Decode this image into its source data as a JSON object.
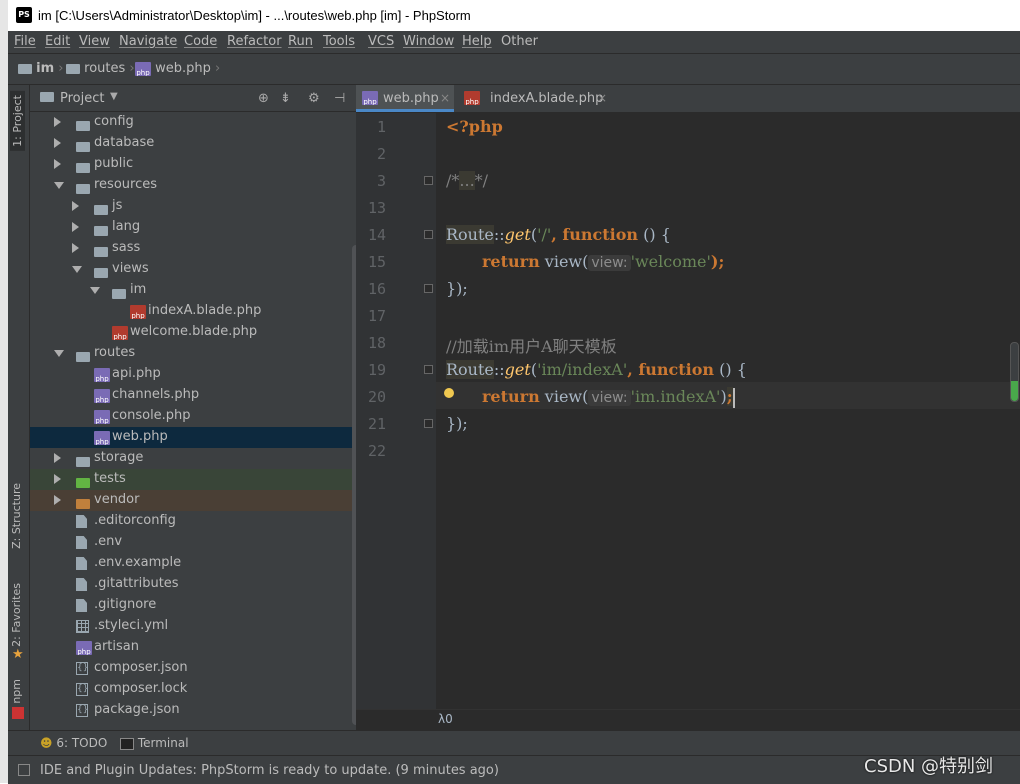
{
  "window": {
    "title": "im [C:\\Users\\Administrator\\Desktop\\im] - ...\\routes\\web.php [im] - PhpStorm",
    "app_icon": "PS"
  },
  "menu": [
    "File",
    "Edit",
    "View",
    "Navigate",
    "Code",
    "Refactor",
    "Run",
    "Tools",
    "VCS",
    "Window",
    "Help",
    "Other"
  ],
  "breadcrumb": [
    "im",
    "routes",
    "web.php"
  ],
  "tool_windows": {
    "left_top": "1: Project",
    "left_structure": "Z: Structure",
    "left_favorites": "2: Favorites",
    "left_npm": "npm"
  },
  "project": {
    "title": "Project",
    "tree": [
      {
        "label": "config",
        "type": "folder",
        "depth": 1,
        "expanded": false
      },
      {
        "label": "database",
        "type": "folder",
        "depth": 1,
        "expanded": false
      },
      {
        "label": "public",
        "type": "folder",
        "depth": 1,
        "expanded": false
      },
      {
        "label": "resources",
        "type": "folder",
        "depth": 1,
        "expanded": true
      },
      {
        "label": "js",
        "type": "folder",
        "depth": 2,
        "expanded": false
      },
      {
        "label": "lang",
        "type": "folder",
        "depth": 2,
        "expanded": false
      },
      {
        "label": "sass",
        "type": "folder",
        "depth": 2,
        "expanded": false
      },
      {
        "label": "views",
        "type": "folder",
        "depth": 2,
        "expanded": true
      },
      {
        "label": "im",
        "type": "folder",
        "depth": 3,
        "expanded": true
      },
      {
        "label": "indexA.blade.php",
        "type": "blade",
        "depth": 4
      },
      {
        "label": "welcome.blade.php",
        "type": "blade",
        "depth": 3
      },
      {
        "label": "routes",
        "type": "folder",
        "depth": 1,
        "expanded": true
      },
      {
        "label": "api.php",
        "type": "php",
        "depth": 2
      },
      {
        "label": "channels.php",
        "type": "php",
        "depth": 2
      },
      {
        "label": "console.php",
        "type": "php",
        "depth": 2
      },
      {
        "label": "web.php",
        "type": "php",
        "depth": 2,
        "selected": true
      },
      {
        "label": "storage",
        "type": "folder",
        "depth": 1,
        "expanded": false
      },
      {
        "label": "tests",
        "type": "folder-green",
        "depth": 1,
        "expanded": false
      },
      {
        "label": "vendor",
        "type": "folder-orange",
        "depth": 1,
        "expanded": false
      },
      {
        "label": ".editorconfig",
        "type": "file",
        "depth": 1
      },
      {
        "label": ".env",
        "type": "file",
        "depth": 1
      },
      {
        "label": ".env.example",
        "type": "file",
        "depth": 1
      },
      {
        "label": ".gitattributes",
        "type": "file",
        "depth": 1
      },
      {
        "label": ".gitignore",
        "type": "file",
        "depth": 1
      },
      {
        "label": ".styleci.yml",
        "type": "grid",
        "depth": 1
      },
      {
        "label": "artisan",
        "type": "php",
        "depth": 1
      },
      {
        "label": "composer.json",
        "type": "json",
        "depth": 1
      },
      {
        "label": "composer.lock",
        "type": "json",
        "depth": 1
      },
      {
        "label": "package.json",
        "type": "json",
        "depth": 1
      }
    ]
  },
  "editor": {
    "tabs": [
      {
        "label": "web.php",
        "active": true
      },
      {
        "label": "indexA.blade.php",
        "active": false
      }
    ],
    "line_numbers": [
      "1",
      "2",
      "3",
      "13",
      "14",
      "15",
      "16",
      "17",
      "18",
      "19",
      "20",
      "21",
      "22"
    ],
    "code": {
      "l1": "<?php",
      "l3a": "/*",
      "l3b": "...",
      "l3c": "*/",
      "route": "Route",
      "sep": "::",
      "get": "get",
      "open": "(",
      "str_root": "'/'",
      "comma": ", ",
      "function_kw": "function",
      "paren_brace": " () {",
      "return_kw": "return",
      "view_fn": " view(",
      "hint_view": "view:",
      "str_welcome": "'welcome'",
      "close_semi": ");",
      "close_block": "});",
      "comment": "//加载im用户A聊天模板",
      "str_im": "'im/indexA'",
      "str_im_index": "'im.indexA'",
      "close_paren": ")",
      "semi": ";"
    },
    "bottom_text": "λ0"
  },
  "bottom_tools": {
    "todo": "6: TODO",
    "terminal": "Terminal"
  },
  "status": "IDE and Plugin Updates: PhpStorm is ready to update. (9 minutes ago)",
  "watermark": "CSDN @特别剑",
  "colors": {
    "keyword": "#cc7832",
    "string": "#6a8759",
    "comment": "#808080",
    "accent": "#4a88c7"
  }
}
